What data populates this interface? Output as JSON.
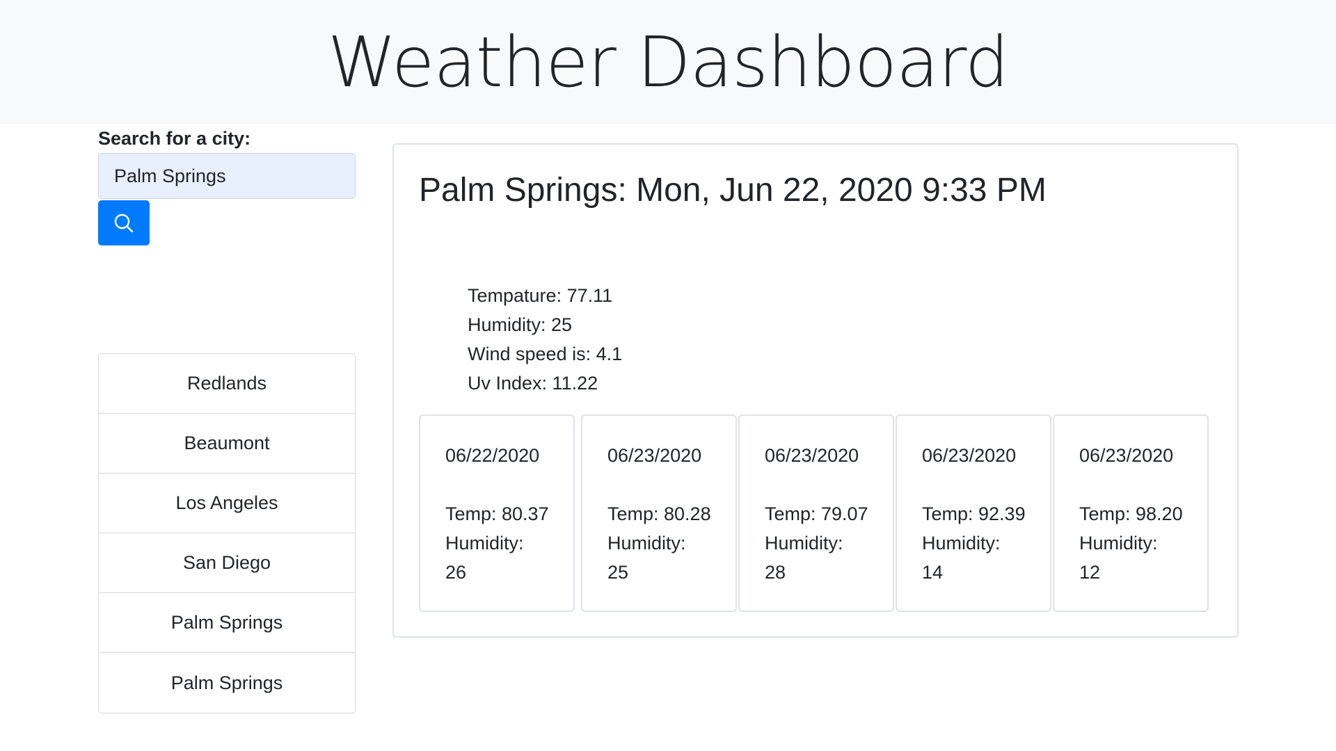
{
  "header": {
    "title": "Weather Dashboard"
  },
  "search": {
    "label": "Search for a city:",
    "value": "Palm Springs",
    "button_icon": "search-icon",
    "button_color": "#007bff"
  },
  "history": [
    {
      "city": "Redlands"
    },
    {
      "city": "Beaumont"
    },
    {
      "city": "Los Angeles"
    },
    {
      "city": "San Diego"
    },
    {
      "city": "Palm Springs"
    },
    {
      "city": "Palm Springs"
    }
  ],
  "current": {
    "title": "Palm Springs: Mon, Jun 22, 2020 9:33 PM",
    "temperature": "Tempature: 77.11",
    "humidity": "Humidity: 25",
    "wind": "Wind speed is: 4.1",
    "uv": "Uv Index: 11.22"
  },
  "forecast": [
    {
      "date": "06/22/2020",
      "temp": "Temp: 80.37",
      "humidity_label": "Humidity:",
      "humidity_value": "26"
    },
    {
      "date": "06/23/2020",
      "temp": "Temp: 80.28",
      "humidity_label": "Humidity:",
      "humidity_value": "25"
    },
    {
      "date": "06/23/2020",
      "temp": "Temp: 79.07",
      "humidity_label": "Humidity:",
      "humidity_value": "28"
    },
    {
      "date": "06/23/2020",
      "temp": "Temp: 92.39",
      "humidity_label": "Humidity:",
      "humidity_value": "14"
    },
    {
      "date": "06/23/2020",
      "temp": "Temp: 98.20",
      "humidity_label": "Humidity:",
      "humidity_value": "12"
    }
  ]
}
